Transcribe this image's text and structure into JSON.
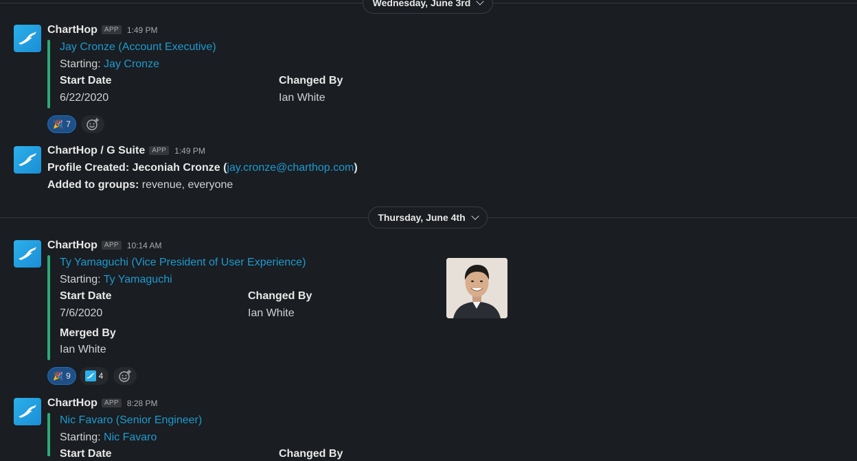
{
  "dates": [
    "Wednesday, June 3rd",
    "Thursday, June 4th"
  ],
  "colors": {
    "background": "#1a1d21",
    "link": "#1d9bd1",
    "attachment_bar": "#2bac76",
    "active_reaction": "#1e4f86"
  },
  "messages": [
    {
      "sender": "ChartHop",
      "badge": "APP",
      "time": "1:49 PM",
      "title": "Jay Cronze (Account Executive)",
      "starting_label": "Starting:",
      "starting_name": "Jay Cronze",
      "field1_label": "Start Date",
      "field1_value": "6/22/2020",
      "field2_label": "Changed By",
      "field2_value": "Ian White",
      "reactions": [
        {
          "icon": "party-popper-icon",
          "count": "7"
        }
      ]
    },
    {
      "sender": "ChartHop / G Suite",
      "badge": "APP",
      "time": "1:49 PM",
      "line1_label": "Profile Created: Jeconiah Cronze (",
      "line1_email": "jay.cronze@charthop.com",
      "line1_end": ")",
      "line2_label": "Added to groups:",
      "line2_value": "revenue, everyone"
    },
    {
      "sender": "ChartHop",
      "badge": "APP",
      "time": "10:14 AM",
      "title": "Ty Yamaguchi (Vice President of User Experience)",
      "starting_label": "Starting:",
      "starting_name": "Ty Yamaguchi",
      "field1_label": "Start Date",
      "field1_value": "7/6/2020",
      "field2_label": "Changed By",
      "field2_value": "Ian White",
      "field3_label": "Merged By",
      "field3_value": "Ian White",
      "reactions": [
        {
          "icon": "party-popper-icon",
          "count": "9"
        },
        {
          "icon": "charthop-icon",
          "count": "4"
        }
      ]
    },
    {
      "sender": "ChartHop",
      "badge": "APP",
      "time": "8:28 PM",
      "title": "Nic Favaro (Senior Engineer)",
      "starting_label": "Starting:",
      "starting_name": "Nic Favaro",
      "field1_label": "Start Date",
      "field2_label": "Changed By"
    }
  ]
}
